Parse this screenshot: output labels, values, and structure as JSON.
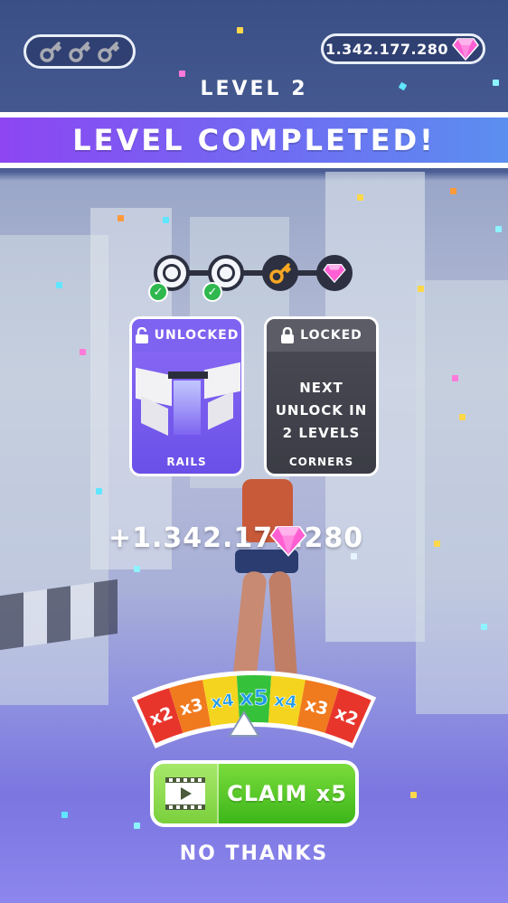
{
  "hud": {
    "keys": [
      "key-icon",
      "key-icon",
      "key-icon"
    ],
    "gem_balance": "1.342.177.280",
    "gem_icon": "pink-gem-icon"
  },
  "level_label": "LEVEL 2",
  "banner_title": "LEVEL COMPLETED!",
  "progress": {
    "nodes": [
      {
        "type": "empty-circle",
        "completed": true
      },
      {
        "type": "empty-circle",
        "completed": true
      },
      {
        "type": "key-icon",
        "completed": false
      },
      {
        "type": "pink-gem-icon",
        "completed": false
      }
    ]
  },
  "cards": {
    "unlocked": {
      "status": "UNLOCKED",
      "name": "RAILS",
      "icon": "unlocked-padlock-icon"
    },
    "locked": {
      "status": "LOCKED",
      "message_line1": "NEXT",
      "message_line2": "UNLOCK IN",
      "message_line3": "2 LEVELS",
      "name": "CORNERS",
      "icon": "locked-padlock-icon"
    }
  },
  "reward_text": "+1.342.177.280",
  "multiplier": {
    "segments": [
      "x2",
      "x3",
      "x4",
      "x5",
      "x4",
      "x3",
      "x2"
    ],
    "colors": [
      "#e8352c",
      "#f07a1e",
      "#f4d41e",
      "#35c23a",
      "#f4d41e",
      "#f07a1e",
      "#e8352c"
    ],
    "selected": "x5"
  },
  "claim_button": {
    "label": "CLAIM x5",
    "icon": "video-film-icon"
  },
  "no_thanks": "NO THANKS",
  "colors": {
    "banner_start": "#8d46f2",
    "banner_end": "#5b8ff0",
    "claim_green": "#3cb61a",
    "check_green": "#2fb84e",
    "gem_pink": "#ff5fd2"
  }
}
